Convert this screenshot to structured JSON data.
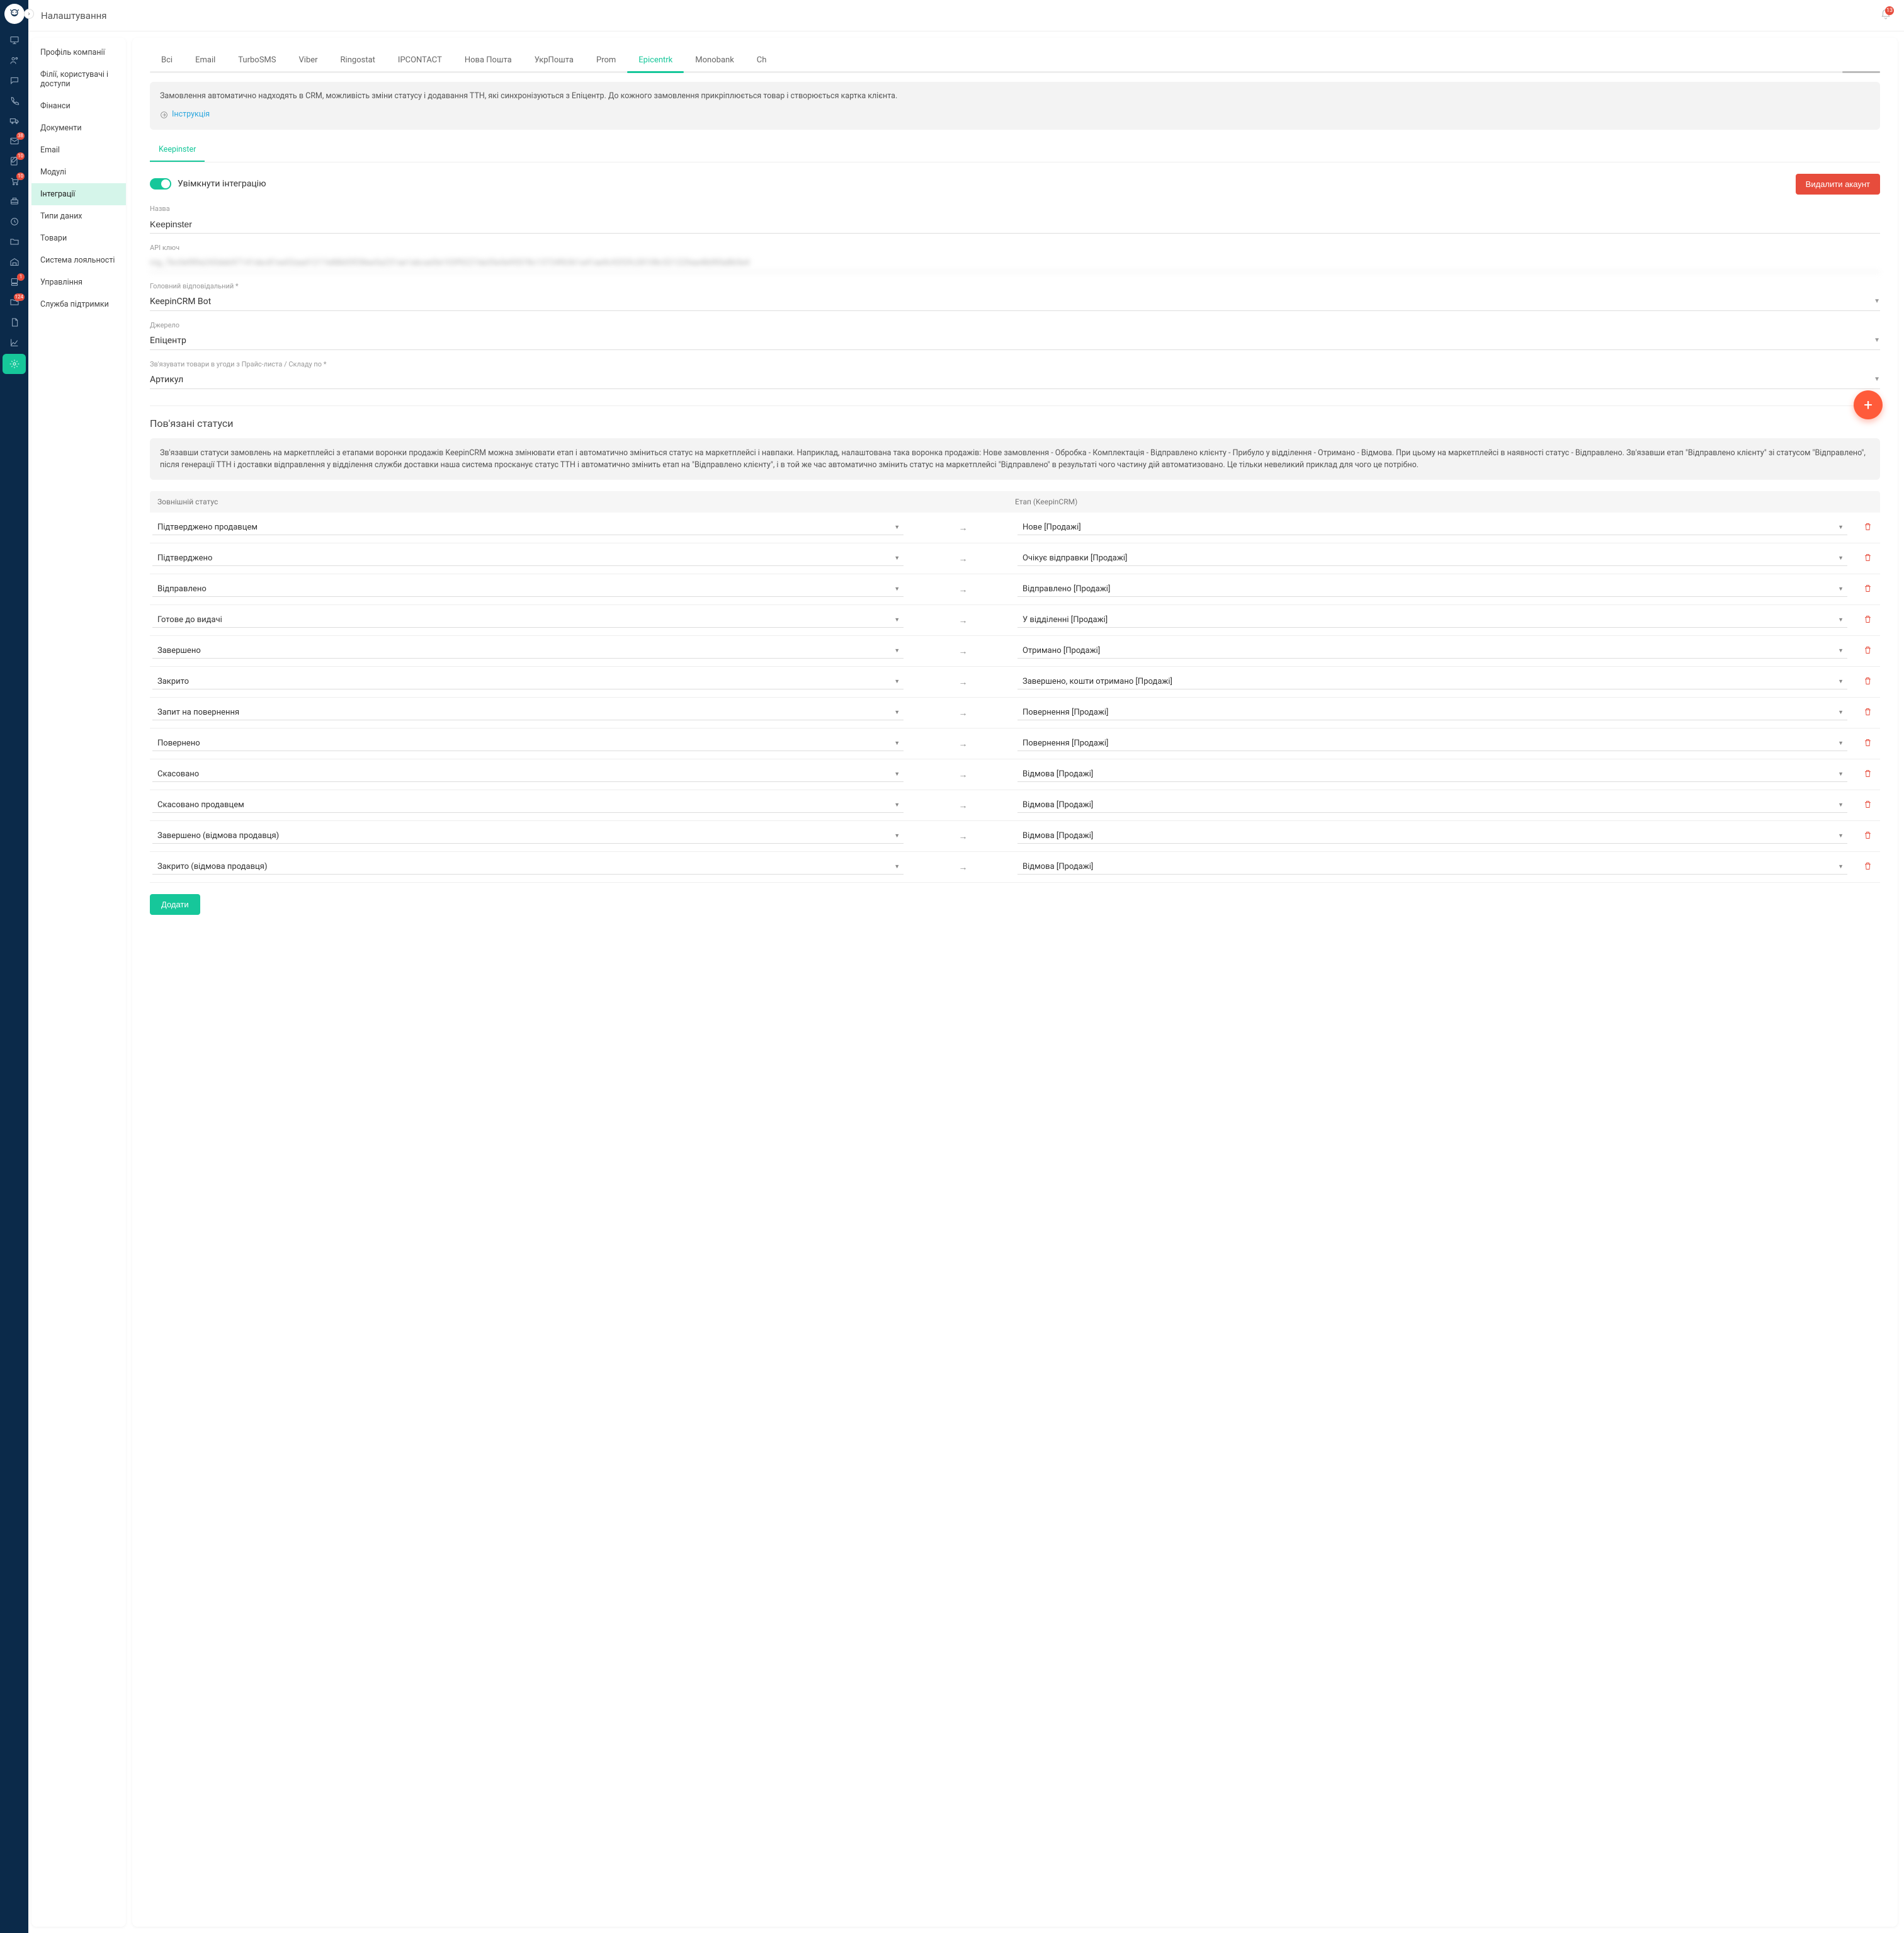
{
  "header": {
    "title": "Налаштування",
    "bell_count": "13"
  },
  "iconrail": {
    "items": [
      {
        "name": "monitor-icon",
        "badge": null
      },
      {
        "name": "users-icon",
        "badge": null
      },
      {
        "name": "chat-icon",
        "badge": null
      },
      {
        "name": "phone-icon",
        "badge": null
      },
      {
        "name": "truck-icon",
        "badge": null
      },
      {
        "name": "mail-icon",
        "badge": "38"
      },
      {
        "name": "edit-icon",
        "badge": "10"
      },
      {
        "name": "cart-icon",
        "badge": "10"
      },
      {
        "name": "cashreg-icon",
        "badge": null
      },
      {
        "name": "clock-icon",
        "badge": null
      },
      {
        "name": "folder-icon",
        "badge": null
      },
      {
        "name": "warehouse-icon",
        "badge": null
      },
      {
        "name": "pos-icon",
        "badge": "1"
      },
      {
        "name": "inbox-icon",
        "badge": "124"
      },
      {
        "name": "document-icon",
        "badge": null
      },
      {
        "name": "chart-icon",
        "badge": null
      },
      {
        "name": "settings-icon",
        "badge": null,
        "active": true
      }
    ]
  },
  "sidebar": {
    "items": [
      "Профіль компанії",
      "Філії, користувачі і доступи",
      "Фінанси",
      "Документи",
      "Email",
      "Модулі",
      "Інтеграції",
      "Типи даних",
      "Товари",
      "Система лояльності",
      "Управління",
      "Служба підтримки"
    ],
    "active_index": 6
  },
  "tabs": {
    "items": [
      "Всі",
      "Email",
      "TurboSMS",
      "Viber",
      "Ringostat",
      "IPCONTACT",
      "Нова Пошта",
      "УкрПошта",
      "Prom",
      "Epicentrk",
      "Monobank",
      "Ch"
    ],
    "active_index": 9
  },
  "info": {
    "text": "Замовлення автоматично надходять в CRM, можливість зміни статусу і додавання ТТН, які синхронізуються з Епіцентр. До кожного замовлення прикріплюється товар і створюється картка клієнта.",
    "instruction": "Інструкція"
  },
  "subtab": "Keepinster",
  "toggle": {
    "label": "Увімкнути інтеграцію",
    "delete": "Видалити акаунт"
  },
  "fields": {
    "name_label": "Назва",
    "name_value": "Keepinster",
    "api_label": "API ключ",
    "api_value": "mg_7bc0ef89a243deb97141dec81ee02aad1217e88b05f38ee5a231ae1abcad3e103f9227da35e5e95578c13724f6361a41ae9c92f2fc28108c521229aa48d90a8b5e4",
    "resp_label": "Головний відповідальний *",
    "resp_value": "KeepinCRM Bot",
    "source_label": "Джерело",
    "source_value": "Епіцентр",
    "bind_label": "Зв'язувати товари в угоди з Прайс-листа / Складу по *",
    "bind_value": "Артикул"
  },
  "statuses": {
    "title": "Пов'язані статуси",
    "info": "Зв'язавши статуси замовлень на маркетплейсі з етапами воронки продажів KeepinCRM можна змінювати етап і автоматично зміниться статус на маркетплейсі і навпаки. Наприклад, налаштована така воронка продажів: Нове замовлення - Обробка - Комплектація - Відправлено клієнту - Прибуло у відділення - Отримано - Відмова. При цьому на маркетплейсі в наявності статус - Відправлено. Зв'язавши етап \"Відправлено клієнту\" зі статусом \"Відправлено\", після генерації ТТН і доставки відправлення у відділення служби доставки наша система просканує статус ТТН і автоматично змінить етап на \"Відправлено клієнту\", і в той же час автоматично змінить статус на маркетплейсі \"Відправлено\" в результаті чого частину дій автоматизовано. Це тільки невеликий приклад для чого це потрібно.",
    "head_ext": "Зовнішній статус",
    "head_int": "Етап (KeepinCRM)",
    "rows": [
      {
        "ext": "Підтверджено продавцем",
        "int": "Нове  [Продажі]"
      },
      {
        "ext": "Підтверджено",
        "int": "Очікує відправки  [Продажі]"
      },
      {
        "ext": "Відправлено",
        "int": "Відправлено  [Продажі]"
      },
      {
        "ext": "Готове до видачі",
        "int": "У відділенні  [Продажі]"
      },
      {
        "ext": "Завершено",
        "int": "Отримано  [Продажі]"
      },
      {
        "ext": "Закрито",
        "int": "Завершено, кошти отримано  [Продажі]"
      },
      {
        "ext": "Запит на повернення",
        "int": "Повернення  [Продажі]"
      },
      {
        "ext": "Повернено",
        "int": "Повернення  [Продажі]"
      },
      {
        "ext": "Скасовано",
        "int": "Відмова  [Продажі]"
      },
      {
        "ext": "Скасовано продавцем",
        "int": "Відмова  [Продажі]"
      },
      {
        "ext": "Завершено (відмова продавця)",
        "int": "Відмова  [Продажі]"
      },
      {
        "ext": "Закрито (відмова продавця)",
        "int": "Відмова  [Продажі]"
      }
    ],
    "add": "Додати"
  }
}
